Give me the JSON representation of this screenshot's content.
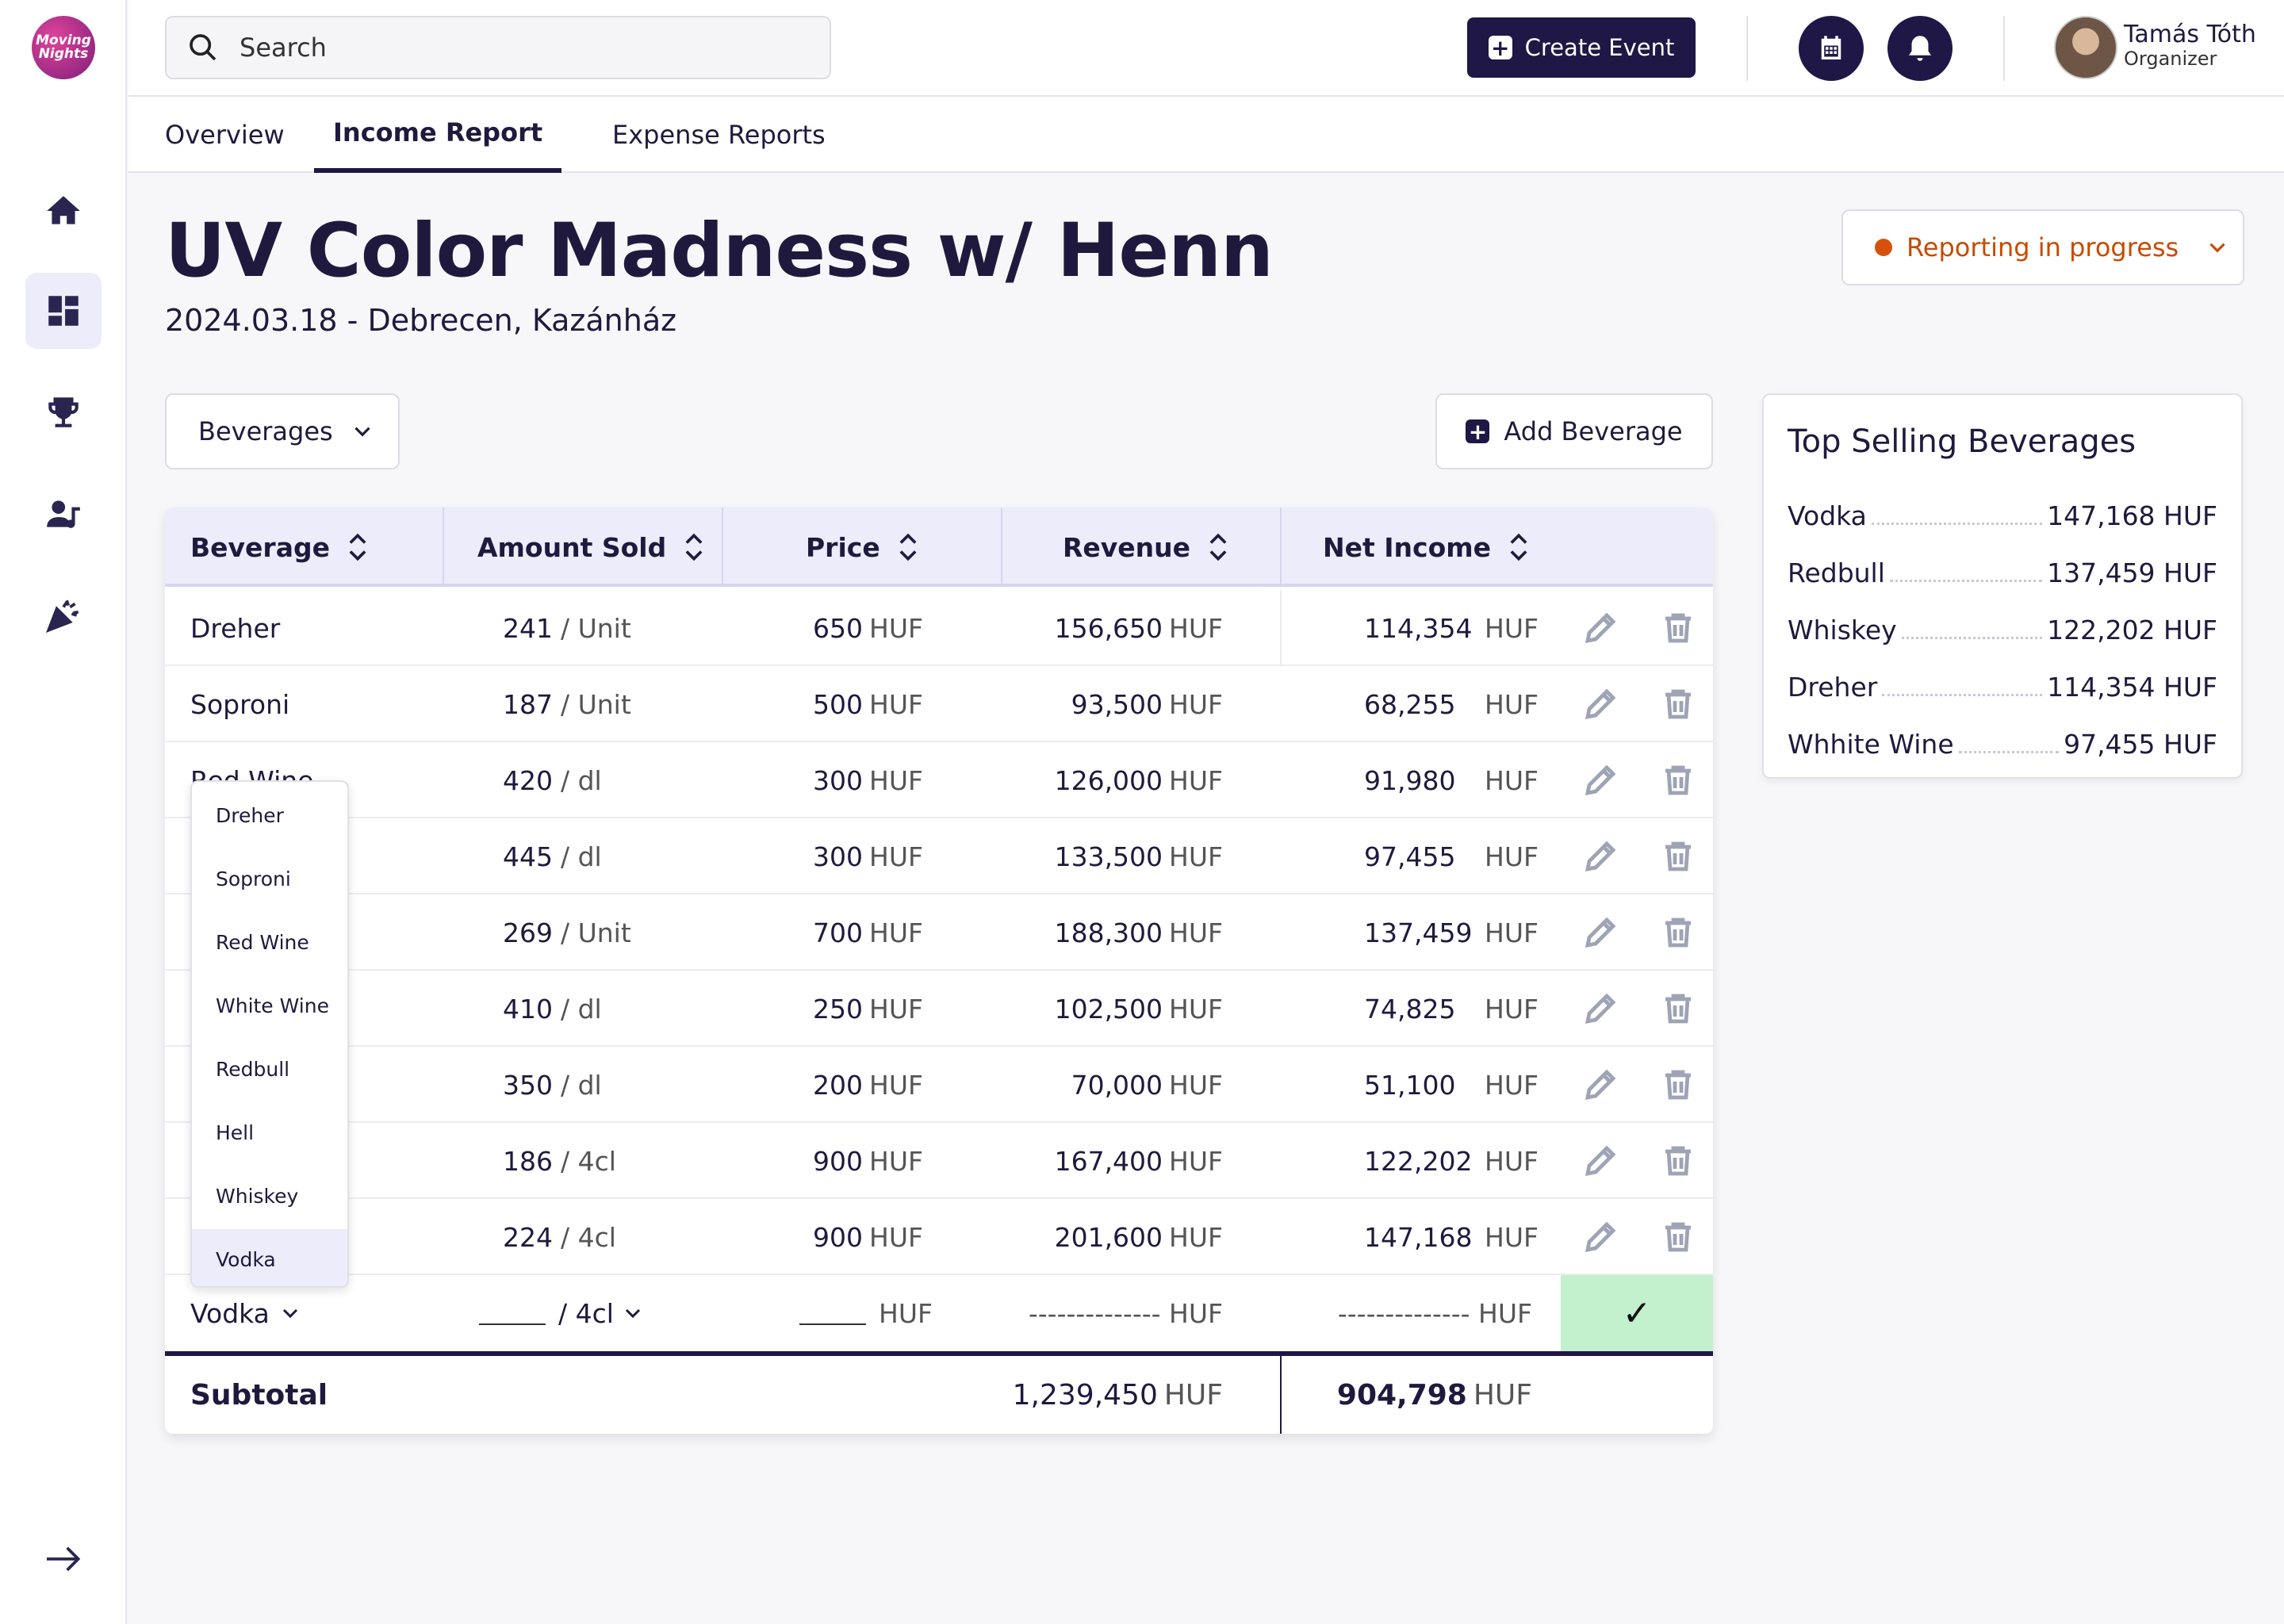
{
  "app": {
    "logo_text": "Moving Nights"
  },
  "sidebar": {
    "items": [
      {
        "name": "home"
      },
      {
        "name": "dashboard",
        "active": true
      },
      {
        "name": "trophy"
      },
      {
        "name": "artists"
      },
      {
        "name": "party"
      }
    ]
  },
  "search": {
    "placeholder": "Search"
  },
  "header": {
    "create_label": "Create Event",
    "user_name": "Tamás Tóth",
    "user_role": "Organizer"
  },
  "tabs": [
    {
      "label": "Overview"
    },
    {
      "label": "Income Report",
      "active": true
    },
    {
      "label": "Expense Reports"
    }
  ],
  "event": {
    "title": "UV Color Madness w/ Henn",
    "subtitle": "2024.03.18 - Debrecen, Kazánház",
    "status": "Reporting in progress"
  },
  "controls": {
    "category": "Beverages",
    "add_label": "Add Beverage"
  },
  "table": {
    "columns": [
      "Beverage",
      "Amount Sold",
      "Price",
      "Revenue",
      "Net Income"
    ],
    "rows": [
      {
        "name": "Dreher",
        "amount": "241",
        "unit": "/ Unit",
        "price": "650",
        "revenue": "156,650",
        "net": "114,354",
        "currency": "HUF"
      },
      {
        "name": "Soproni",
        "amount": "187",
        "unit": "/ Unit",
        "price": "500",
        "revenue": "93,500",
        "net": "68,255",
        "currency": "HUF"
      },
      {
        "name": "Red Wine",
        "amount": "420",
        "unit": "/ dl",
        "price": "300",
        "revenue": "126,000",
        "net": "91,980",
        "currency": "HUF"
      },
      {
        "name": "",
        "amount": "445",
        "unit": "/ dl",
        "price": "300",
        "revenue": "133,500",
        "net": "97,455",
        "currency": "HUF"
      },
      {
        "name": "",
        "amount": "269",
        "unit": "/ Unit",
        "price": "700",
        "revenue": "188,300",
        "net": "137,459",
        "currency": "HUF"
      },
      {
        "name": "",
        "amount": "410",
        "unit": "/ dl",
        "price": "250",
        "revenue": "102,500",
        "net": "74,825",
        "currency": "HUF"
      },
      {
        "name": "",
        "amount": "350",
        "unit": "/ dl",
        "price": "200",
        "revenue": "70,000",
        "net": "51,100",
        "currency": "HUF"
      },
      {
        "name": "",
        "amount": "186",
        "unit": "/ 4cl",
        "price": "900",
        "revenue": "167,400",
        "net": "122,202",
        "currency": "HUF"
      },
      {
        "name": "",
        "amount": "224",
        "unit": "/ 4cl",
        "price": "900",
        "revenue": "201,600",
        "net": "147,168",
        "currency": "HUF"
      }
    ],
    "new_row": {
      "name": "Vodka",
      "unit": "/ 4cl",
      "currency": "HUF",
      "revenue_placeholder": "-------------- HUF",
      "net_placeholder": "-------------- HUF",
      "confirm": "✓"
    },
    "subtotal": {
      "label": "Subtotal",
      "revenue": "1,239,450",
      "net": "904,798",
      "currency": "HUF"
    }
  },
  "dropdown": {
    "options": [
      "Dreher",
      "Soproni",
      "Red Wine",
      "White Wine",
      "Redbull",
      "Hell",
      "Whiskey",
      "Vodka"
    ],
    "selected": "Vodka"
  },
  "top_selling": {
    "title": "Top Selling Beverages",
    "items": [
      {
        "name": "Vodka",
        "value": "147,168 HUF"
      },
      {
        "name": "Redbull",
        "value": "137,459 HUF"
      },
      {
        "name": "Whiskey",
        "value": "122,202 HUF"
      },
      {
        "name": "Dreher",
        "value": "114,354 HUF"
      },
      {
        "name": "Whhite Wine",
        "value": "97,455 HUF"
      }
    ]
  },
  "colors": {
    "primary": "#1f1745",
    "accent_bg": "#ececfb",
    "status": "#d6510b",
    "confirm_bg": "#c3f0cd"
  }
}
